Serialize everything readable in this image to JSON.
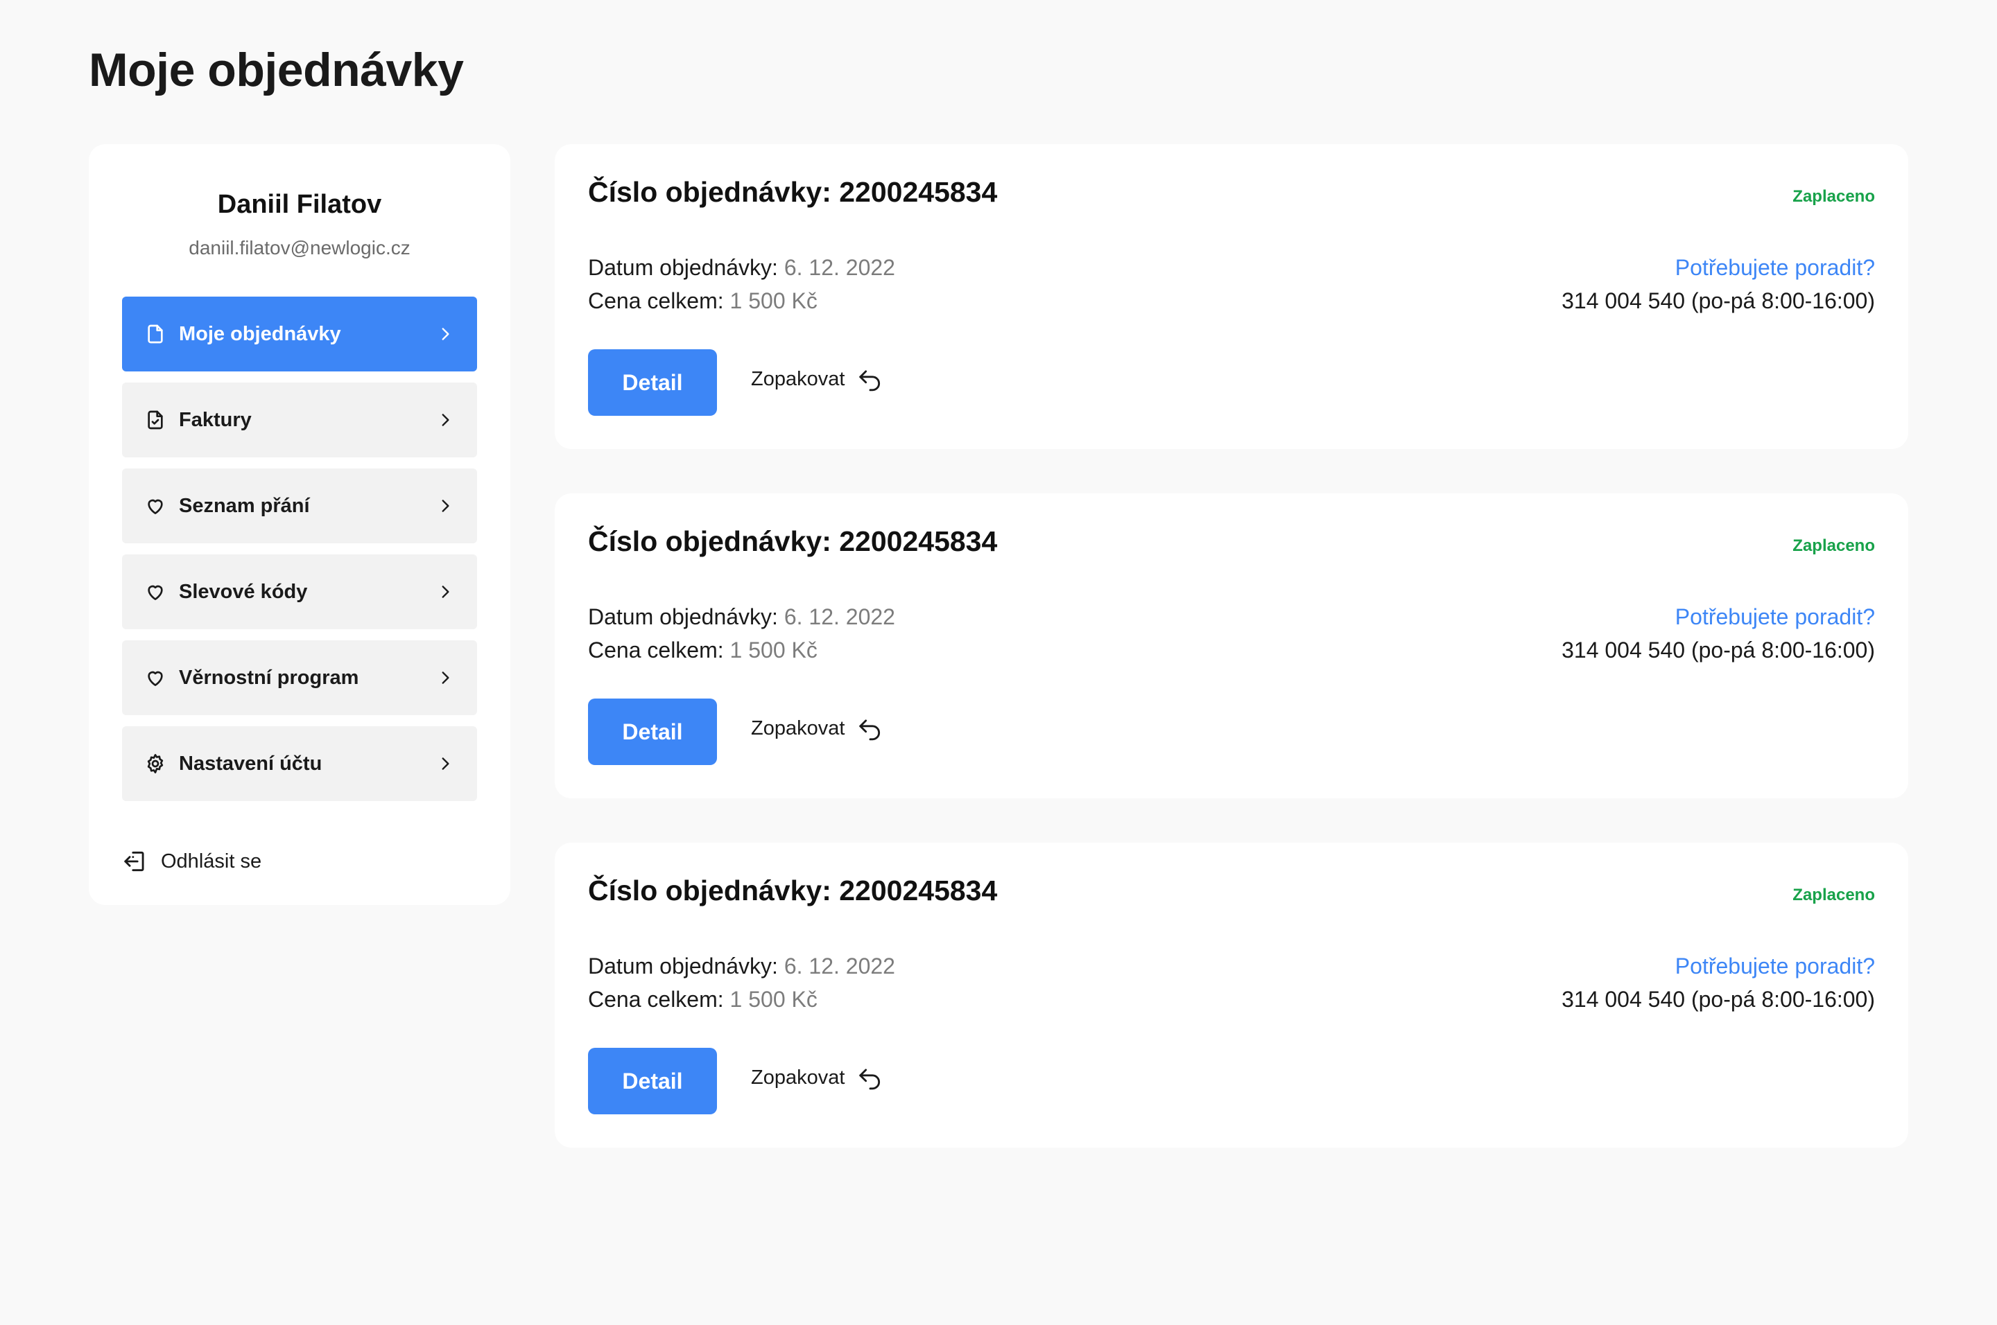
{
  "page": {
    "title": "Moje objednávky"
  },
  "sidebar": {
    "user_name": "Daniil Filatov",
    "user_email": "daniil.filatov@newlogic.cz",
    "items": [
      {
        "label": "Moje objednávky",
        "icon": "document-icon",
        "active": true
      },
      {
        "label": "Faktury",
        "icon": "invoice-icon",
        "active": false
      },
      {
        "label": "Seznam přání",
        "icon": "heart-icon",
        "active": false
      },
      {
        "label": "Slevové kódy",
        "icon": "heart-icon",
        "active": false
      },
      {
        "label": "Věrnostní program",
        "icon": "heart-icon",
        "active": false
      },
      {
        "label": "Nastavení účtu",
        "icon": "gear-icon",
        "active": false
      }
    ],
    "logout_label": "Odhlásit se"
  },
  "orders": [
    {
      "number_label": "Číslo objednávky: 2200245834",
      "status": "Zaplaceno",
      "date_label": "Datum objednávky:",
      "date_value": "6. 12. 2022",
      "price_label": "Cena celkem:",
      "price_value": "1 500 Kč",
      "help_link": "Potřebujete poradit?",
      "help_phone": "314 004 540 (po-pá 8:00-16:00)",
      "detail_label": "Detail",
      "repeat_label": "Zopakovat"
    },
    {
      "number_label": "Číslo objednávky: 2200245834",
      "status": "Zaplaceno",
      "date_label": "Datum objednávky:",
      "date_value": "6. 12. 2022",
      "price_label": "Cena celkem:",
      "price_value": "1 500 Kč",
      "help_link": "Potřebujete poradit?",
      "help_phone": "314 004 540 (po-pá 8:00-16:00)",
      "detail_label": "Detail",
      "repeat_label": "Zopakovat"
    },
    {
      "number_label": "Číslo objednávky: 2200245834",
      "status": "Zaplaceno",
      "date_label": "Datum objednávky:",
      "date_value": "6. 12. 2022",
      "price_label": "Cena celkem:",
      "price_value": "1 500 Kč",
      "help_link": "Potřebujete poradit?",
      "help_phone": "314 004 540 (po-pá 8:00-16:00)",
      "detail_label": "Detail",
      "repeat_label": "Zopakovat"
    }
  ],
  "colors": {
    "accent": "#3d86f6",
    "status_paid": "#18a24a",
    "background": "#f9f9f9"
  }
}
